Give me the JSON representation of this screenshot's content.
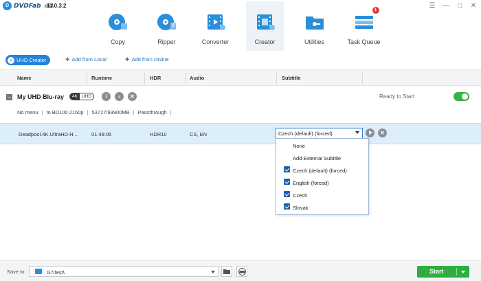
{
  "app": {
    "logo_badge": "D",
    "logo_text": "DVDFab",
    "arch": "x64",
    "version": "11.0.3.2"
  },
  "modules": [
    {
      "label": "Copy",
      "icon": "copy-disc-icon",
      "color": "#2a8fd8"
    },
    {
      "label": "Ripper",
      "icon": "ripper-disc-icon",
      "color": "#2a8fd8"
    },
    {
      "label": "Converter",
      "icon": "converter-film-icon",
      "color": "#2a8fd8"
    },
    {
      "label": "Creator",
      "icon": "creator-film-icon",
      "color": "#2a8fd8",
      "active": true
    },
    {
      "label": "Utilities",
      "icon": "utilities-folder-icon",
      "color": "#2a8fd8"
    },
    {
      "label": "Task Queue",
      "icon": "task-queue-icon",
      "color": "#2a8fd8",
      "badge": "1"
    }
  ],
  "toolbar": {
    "mode_label": "UHD Creator",
    "add_local": "Add from Local",
    "add_online": "Add from Online"
  },
  "columns": {
    "name": "Name",
    "runtime": "Runtime",
    "hdr": "HDR",
    "audio": "Audio",
    "subtitle": "Subtitle"
  },
  "disc": {
    "title": "My UHD Blu-ray",
    "tag_a": "4K",
    "tag_b": "UHD",
    "status": "Ready to Start",
    "enabled": true,
    "info": [
      "No menu",
      "to BD100 2160p",
      "53727/93900MB",
      "Passthrough"
    ]
  },
  "title_row": {
    "name": "Deadpool.4K.UltraHD.H...",
    "runtime": "01:48:06",
    "hdr": "HDR10",
    "audio": "CS, EN",
    "subtitle_selected": "Czech (default) (forced)"
  },
  "subtitle_options": [
    {
      "label": "None",
      "checked": false
    },
    {
      "label": "Add External Subtitle",
      "checked": false
    },
    {
      "label": "Czech (default) (forced)",
      "checked": true
    },
    {
      "label": "English  (forced)",
      "checked": true
    },
    {
      "label": "Czech",
      "checked": true
    },
    {
      "label": "Slovak",
      "checked": true
    }
  ],
  "bottom": {
    "save_to": "Save to:",
    "path": "G:\\Test\\",
    "start": "Start"
  },
  "colors": {
    "accent": "#2583d8",
    "selection": "#ddeefb",
    "start": "#2fae3f",
    "toggle_on": "#36b24a"
  }
}
